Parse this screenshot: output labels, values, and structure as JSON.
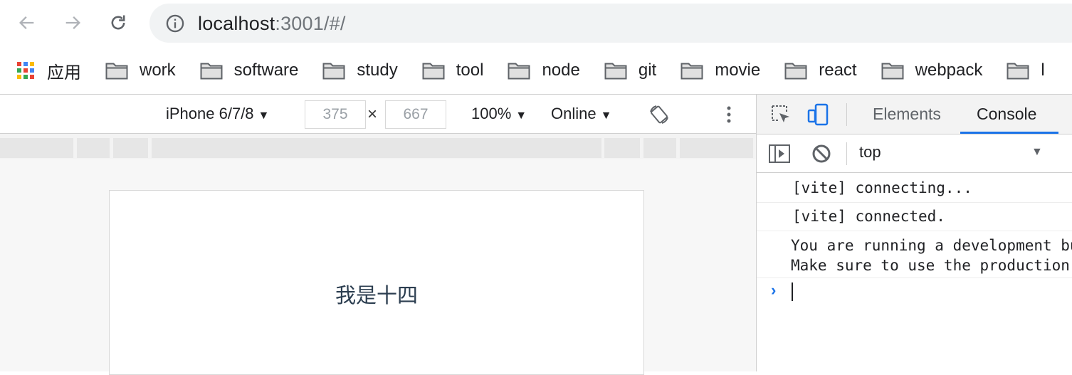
{
  "browser": {
    "url_host": "localhost",
    "url_path": ":3001/#/"
  },
  "bookmarks": {
    "apps_label": "应用",
    "items": [
      {
        "label": "work"
      },
      {
        "label": "software"
      },
      {
        "label": "study"
      },
      {
        "label": "tool"
      },
      {
        "label": "node"
      },
      {
        "label": "git"
      },
      {
        "label": "movie"
      },
      {
        "label": "react"
      },
      {
        "label": "webpack"
      },
      {
        "label": "l"
      }
    ]
  },
  "device_toolbar": {
    "device": "iPhone 6/7/8",
    "width": "375",
    "height": "667",
    "times": "×",
    "zoom": "100%",
    "throttle": "Online",
    "caret": "▼"
  },
  "page": {
    "text": "我是十四"
  },
  "devtools": {
    "tabs": [
      {
        "label": "Elements"
      },
      {
        "label": "Console"
      }
    ],
    "context": "top",
    "caret": "▼",
    "logs": [
      {
        "text": "[vite] connecting..."
      },
      {
        "text": "[vite] connected."
      },
      {
        "text": "You are running a development build of Vue.\nMake sure to use the production build (*.prod.js) when deploying for production."
      }
    ],
    "prompt": "›"
  }
}
